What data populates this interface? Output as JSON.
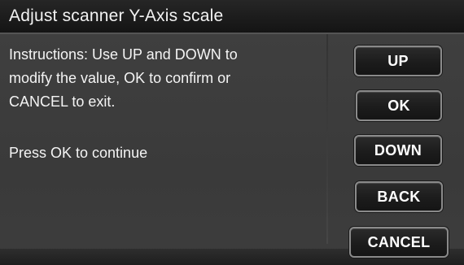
{
  "title": "Adjust scanner Y-Axis scale",
  "instructions": {
    "line1": "Instructions: Use UP and DOWN to",
    "line2": "modify the value, OK to confirm or",
    "line3": "CANCEL to exit."
  },
  "prompt": "Press OK to continue",
  "buttons": {
    "up": "UP",
    "ok": "OK",
    "down": "DOWN",
    "back": "BACK",
    "cancel": "CANCEL"
  }
}
